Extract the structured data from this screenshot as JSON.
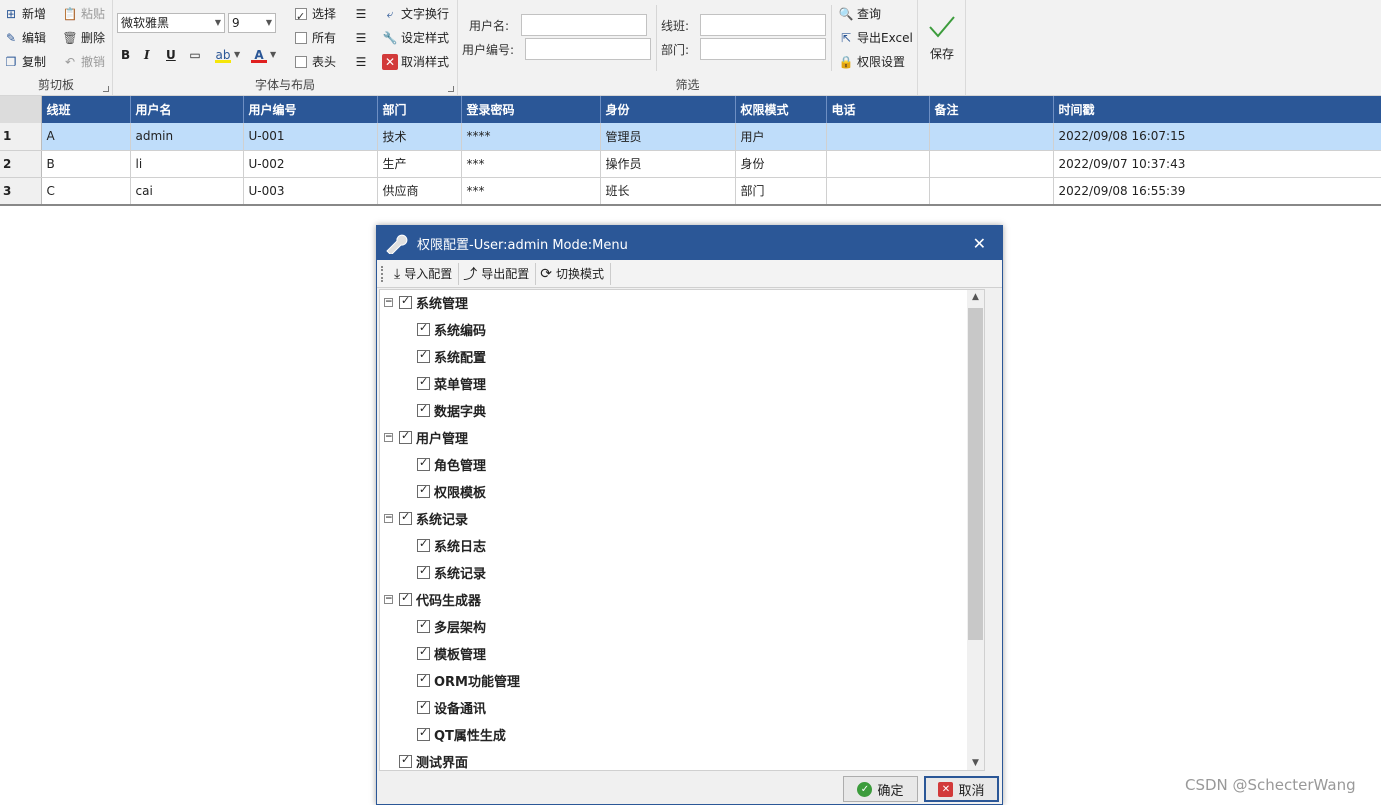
{
  "ribbon": {
    "clipboard": {
      "new": "新增",
      "edit": "编辑",
      "copy": "复制",
      "paste": "粘贴",
      "delete": "删除",
      "undo": "撤销",
      "label": "剪切板"
    },
    "font": {
      "family": "微软雅黑",
      "size": "9",
      "bold": "B",
      "italic": "I",
      "underline": "U",
      "select": "选择",
      "all": "所有",
      "header": "表头",
      "wrap": "文字换行",
      "set_style": "设定样式",
      "cancel_style": "取消样式",
      "label": "字体与布局"
    },
    "filter": {
      "username_label": "用户名:",
      "userno_label": "用户编号:",
      "line_label": "线班:",
      "dept_label": "部门:",
      "query": "查询",
      "export_excel": "导出Excel",
      "perm_settings": "权限设置",
      "label": "筛选"
    },
    "save": "保存"
  },
  "grid": {
    "columns": [
      "线班",
      "用户名",
      "用户编号",
      "部门",
      "登录密码",
      "身份",
      "权限模式",
      "电话",
      "备注",
      "时间戳"
    ],
    "rows": [
      {
        "idx": "1",
        "cells": [
          "A",
          "admin",
          "U-001",
          "技术",
          "****",
          "管理员",
          "用户",
          "",
          "",
          "2022/09/08 16:07:15"
        ]
      },
      {
        "idx": "2",
        "cells": [
          "B",
          "li",
          "U-002",
          "生产",
          "***",
          "操作员",
          "身份",
          "",
          "",
          "2022/09/07 10:37:43"
        ]
      },
      {
        "idx": "3",
        "cells": [
          "C",
          "cai",
          "U-003",
          "供应商",
          "***",
          "班长",
          "部门",
          "",
          "",
          "2022/09/08 16:55:39"
        ]
      }
    ]
  },
  "dialog": {
    "title": "权限配置-User:admin Mode:Menu",
    "toolbar": {
      "import": "导入配置",
      "export": "导出配置",
      "switch": "切换模式"
    },
    "tree": [
      {
        "label": "系统管理",
        "level": 0,
        "expander": "−"
      },
      {
        "label": "系统编码",
        "level": 1
      },
      {
        "label": "系统配置",
        "level": 1
      },
      {
        "label": "菜单管理",
        "level": 1
      },
      {
        "label": "数据字典",
        "level": 1
      },
      {
        "label": "用户管理",
        "level": 0,
        "expander": "−"
      },
      {
        "label": "角色管理",
        "level": 1
      },
      {
        "label": "权限模板",
        "level": 1
      },
      {
        "label": "系统记录",
        "level": 0,
        "expander": "−"
      },
      {
        "label": "系统日志",
        "level": 1
      },
      {
        "label": "系统记录",
        "level": 1
      },
      {
        "label": "代码生成器",
        "level": 0,
        "expander": "−"
      },
      {
        "label": "多层架构",
        "level": 1
      },
      {
        "label": "模板管理",
        "level": 1
      },
      {
        "label": "ORM功能管理",
        "level": 1
      },
      {
        "label": "设备通讯",
        "level": 1
      },
      {
        "label": "QT属性生成",
        "level": 1
      },
      {
        "label": "测试界面",
        "level": 0
      }
    ],
    "ok": "确定",
    "cancel": "取消"
  },
  "watermark": "CSDN @SchecterWang",
  "colors": {
    "accent": "#2b5797",
    "selection": "#bfddfa"
  }
}
